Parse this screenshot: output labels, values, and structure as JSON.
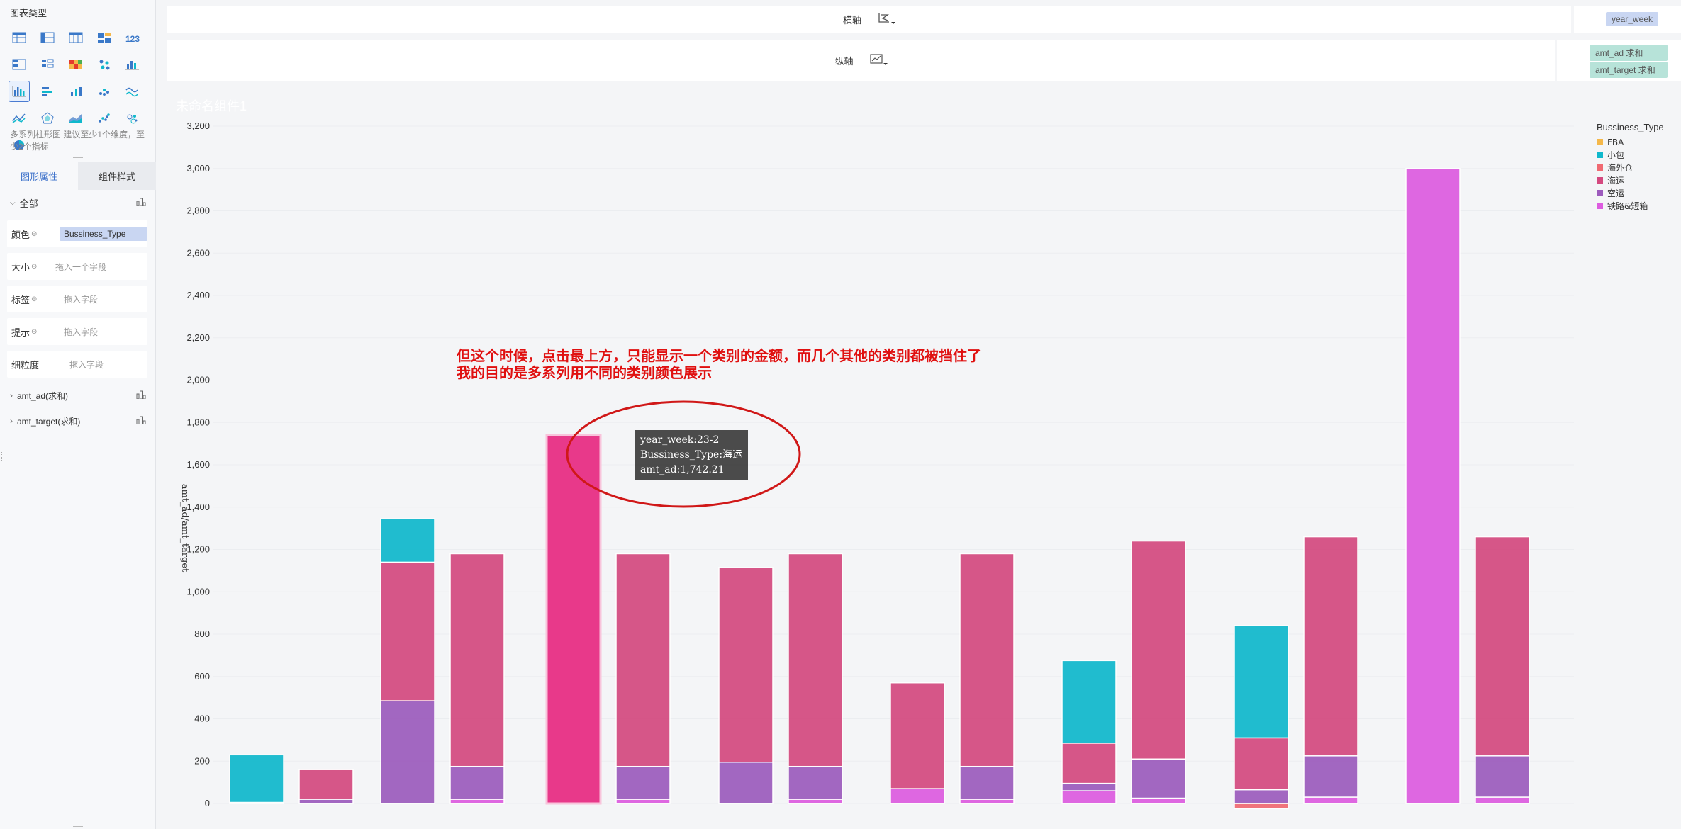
{
  "left": {
    "chart_type_title": "图表类型",
    "chart_hint": "多系列柱形图 建议至少1个维度，至少2个指标",
    "tabs": [
      "图形属性",
      "组件样式"
    ],
    "all_label": "全部",
    "fields": [
      {
        "label": "颜色",
        "value": "Bussiness_Type",
        "filled": true
      },
      {
        "label": "大小",
        "value": "拖入一个字段",
        "filled": false
      },
      {
        "label": "标签",
        "value": "拖入字段",
        "filled": false
      },
      {
        "label": "提示",
        "value": "拖入字段",
        "filled": false
      },
      {
        "label": "细粒度",
        "value": "拖入字段",
        "filled": false
      }
    ],
    "measures": [
      "amt_ad(求和)",
      "amt_target(求和)"
    ]
  },
  "toolbar": {
    "x_axis_label": "横轴",
    "x_axis_field": "year_week",
    "y_axis_label": "纵轴",
    "y_axis_fields": [
      "amt_ad 求和",
      "amt_target 求和"
    ]
  },
  "chart_title": "未命名组件1",
  "annotation": {
    "line1": "但这个时候，点击最上方，只能显示一个类别的金额，而几个其他的类别都被挡住了",
    "line2": "我的目的是多系列用不同的类别颜色展示"
  },
  "tooltip": {
    "line1": "year_week:23-2",
    "line2": "Bussiness_Type:海运",
    "line3": "amt_ad:1,742.21"
  },
  "colors": {
    "FBA": "#f5b84a",
    "小包": "#0fb8cc",
    "海外仓": "#f06a72",
    "海运": "#d4497f",
    "空运": "#9c5bbd",
    "铁路&短箱": "#dd5ce0",
    "highlight": "#e8398a",
    "accent": "#3a6fc9"
  },
  "chart_data": {
    "type": "bar",
    "stacked": true,
    "ylabel": "amt_ad/amt_target",
    "ylim": [
      0,
      3200
    ],
    "yticks": [
      "0",
      "200",
      "400",
      "600",
      "800",
      "1,000",
      "1,200",
      "1,400",
      "1,600",
      "1,800",
      "2,000",
      "2,200",
      "2,400",
      "2,600",
      "2,800",
      "3,000",
      "3,200"
    ],
    "legend_title": "Bussiness_Type",
    "legend": [
      "FBA",
      "小包",
      "海外仓",
      "海运",
      "空运",
      "铁路&短箱"
    ],
    "legend_position": "top-right",
    "bars": [
      {
        "group": 1,
        "measure": "amt_ad",
        "segments": [
          {
            "type": "空运",
            "value": 5
          },
          {
            "type": "小包",
            "value": 225
          }
        ]
      },
      {
        "group": 1,
        "measure": "amt_target",
        "segments": [
          {
            "type": "空运",
            "value": 20
          },
          {
            "type": "海运",
            "value": 140
          }
        ]
      },
      {
        "group": 2,
        "measure": "amt_ad",
        "segments": [
          {
            "type": "空运",
            "value": 485
          },
          {
            "type": "海运",
            "value": 655
          },
          {
            "type": "小包",
            "value": 205
          }
        ]
      },
      {
        "group": 2,
        "measure": "amt_target",
        "segments": [
          {
            "type": "铁路&短箱",
            "value": 20
          },
          {
            "type": "空运",
            "value": 155
          },
          {
            "type": "海运",
            "value": 1005
          }
        ]
      },
      {
        "group": 3,
        "measure": "amt_ad",
        "segments": [
          {
            "type": "海运",
            "value": 1742.21,
            "highlight": true
          }
        ]
      },
      {
        "group": 3,
        "measure": "amt_target",
        "segments": [
          {
            "type": "铁路&短箱",
            "value": 20
          },
          {
            "type": "空运",
            "value": 155
          },
          {
            "type": "海运",
            "value": 1005
          }
        ]
      },
      {
        "group": 4,
        "measure": "amt_ad",
        "segments": [
          {
            "type": "空运",
            "value": 195
          },
          {
            "type": "海运",
            "value": 920
          }
        ]
      },
      {
        "group": 4,
        "measure": "amt_target",
        "segments": [
          {
            "type": "铁路&短箱",
            "value": 20
          },
          {
            "type": "空运",
            "value": 155
          },
          {
            "type": "海运",
            "value": 1005
          }
        ]
      },
      {
        "group": 5,
        "measure": "amt_ad",
        "segments": [
          {
            "type": "铁路&短箱",
            "value": 70
          },
          {
            "type": "海运",
            "value": 500
          }
        ]
      },
      {
        "group": 5,
        "measure": "amt_target",
        "segments": [
          {
            "type": "铁路&短箱",
            "value": 20
          },
          {
            "type": "空运",
            "value": 155
          },
          {
            "type": "海运",
            "value": 1005
          }
        ]
      },
      {
        "group": 6,
        "measure": "amt_ad",
        "segments": [
          {
            "type": "铁路&短箱",
            "value": 60
          },
          {
            "type": "空运",
            "value": 35
          },
          {
            "type": "海运",
            "value": 190
          },
          {
            "type": "小包",
            "value": 390
          }
        ]
      },
      {
        "group": 6,
        "measure": "amt_target",
        "segments": [
          {
            "type": "铁路&短箱",
            "value": 25
          },
          {
            "type": "空运",
            "value": 185
          },
          {
            "type": "海运",
            "value": 1030
          }
        ]
      },
      {
        "group": 7,
        "measure": "amt_ad",
        "segments": [
          {
            "type": "海外仓",
            "value": -25
          },
          {
            "type": "空运",
            "value": 65
          },
          {
            "type": "海运",
            "value": 245
          },
          {
            "type": "小包",
            "value": 530
          }
        ]
      },
      {
        "group": 7,
        "measure": "amt_target",
        "segments": [
          {
            "type": "铁路&短箱",
            "value": 30
          },
          {
            "type": "空运",
            "value": 195
          },
          {
            "type": "海运",
            "value": 1035
          }
        ]
      },
      {
        "group": 8,
        "measure": "amt_ad",
        "segments": [
          {
            "type": "铁路&短箱",
            "value": 3000
          }
        ]
      },
      {
        "group": 8,
        "measure": "amt_target",
        "segments": [
          {
            "type": "铁路&短箱",
            "value": 30
          },
          {
            "type": "空运",
            "value": 195
          },
          {
            "type": "海运",
            "value": 1035
          }
        ]
      }
    ]
  }
}
